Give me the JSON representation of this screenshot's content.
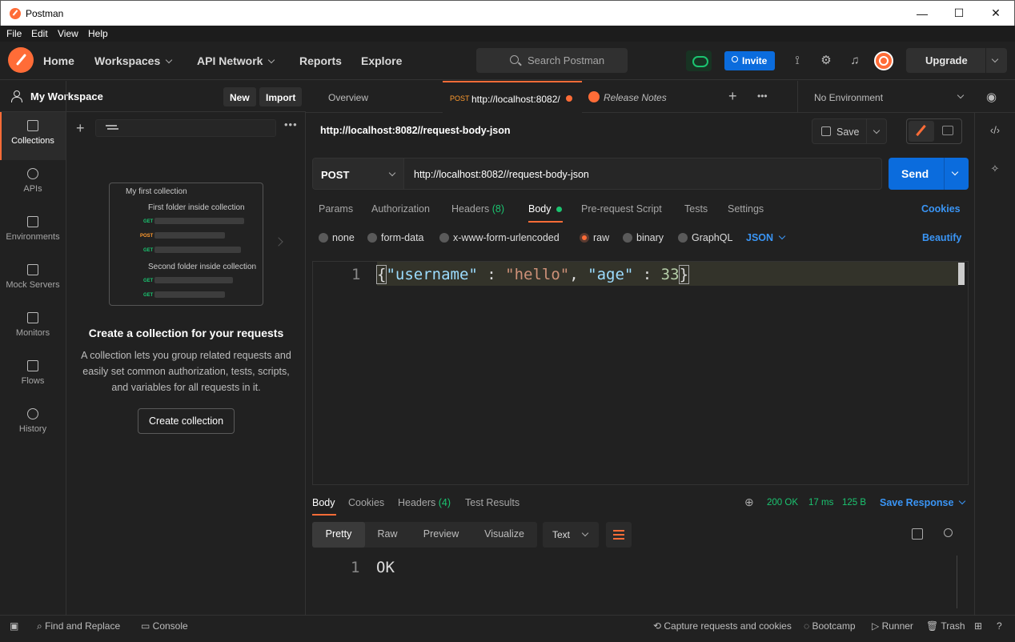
{
  "window": {
    "title": "Postman",
    "min": "—",
    "max": "☐",
    "close": "✕"
  },
  "menu": [
    "File",
    "Edit",
    "View",
    "Help"
  ],
  "header": {
    "home": "Home",
    "workspaces": "Workspaces",
    "api_network": "API Network",
    "reports": "Reports",
    "explore": "Explore",
    "search_placeholder": "Search Postman",
    "invite": "Invite",
    "upgrade": "Upgrade"
  },
  "workspace": {
    "title": "My Workspace",
    "new": "New",
    "import": "Import"
  },
  "rail": [
    {
      "label": "Collections"
    },
    {
      "label": "APIs"
    },
    {
      "label": "Environments"
    },
    {
      "label": "Mock Servers"
    },
    {
      "label": "Monitors"
    },
    {
      "label": "Flows"
    },
    {
      "label": "History"
    }
  ],
  "illustration": {
    "collection": "My first collection",
    "folder1": "First folder inside collection",
    "folder2": "Second folder inside collection",
    "get": "GET",
    "post": "POST"
  },
  "empty": {
    "title": "Create a collection for your requests",
    "desc": "A collection lets you group related requests and easily set common authorization, tests, scripts, and variables for all requests in it.",
    "button": "Create collection"
  },
  "tabs": {
    "overview": "Overview",
    "active_method": "POST",
    "active_url": "http://localhost:8082/",
    "release": "Release Notes",
    "env": "No Environment",
    "more": "•••"
  },
  "request": {
    "title": "http://localhost:8082//request-body-json",
    "save": "Save",
    "method": "POST",
    "url": "http://localhost:8082//request-body-json",
    "send": "Send"
  },
  "req_tabs": {
    "params": "Params",
    "auth": "Authorization",
    "headers": "Headers",
    "headers_count": "(8)",
    "body": "Body",
    "prereq": "Pre-request Script",
    "tests": "Tests",
    "settings": "Settings",
    "cookies": "Cookies"
  },
  "body_types": {
    "none": "none",
    "form": "form-data",
    "urlenc": "x-www-form-urlencoded",
    "raw": "raw",
    "binary": "binary",
    "graphql": "GraphQL",
    "json": "JSON",
    "beautify": "Beautify"
  },
  "editor": {
    "line": "1",
    "open": "{",
    "k1": "\"username\"",
    "colon": " : ",
    "v1": "\"hello\"",
    "comma": ", ",
    "k2": "\"age\"",
    "colon2": " : ",
    "v2": "33",
    "close": "}"
  },
  "response": {
    "body": "Body",
    "cookies": "Cookies",
    "headers": "Headers",
    "headers_count": "(4)",
    "tests": "Test Results",
    "status": "200 OK",
    "time": "17 ms",
    "size": "125 B",
    "save": "Save Response",
    "pretty": "Pretty",
    "raw": "Raw",
    "preview": "Preview",
    "visualize": "Visualize",
    "format": "Text",
    "line": "1",
    "text": "OK"
  },
  "statusbar": {
    "find": "Find and Replace",
    "console": "Console",
    "capture": "Capture requests and cookies",
    "bootcamp": "Bootcamp",
    "runner": "Runner",
    "trash": "Trash"
  },
  "colors": {
    "accent": "#ff6c37",
    "blue": "#0b6cdd",
    "green": "#1bc470"
  }
}
